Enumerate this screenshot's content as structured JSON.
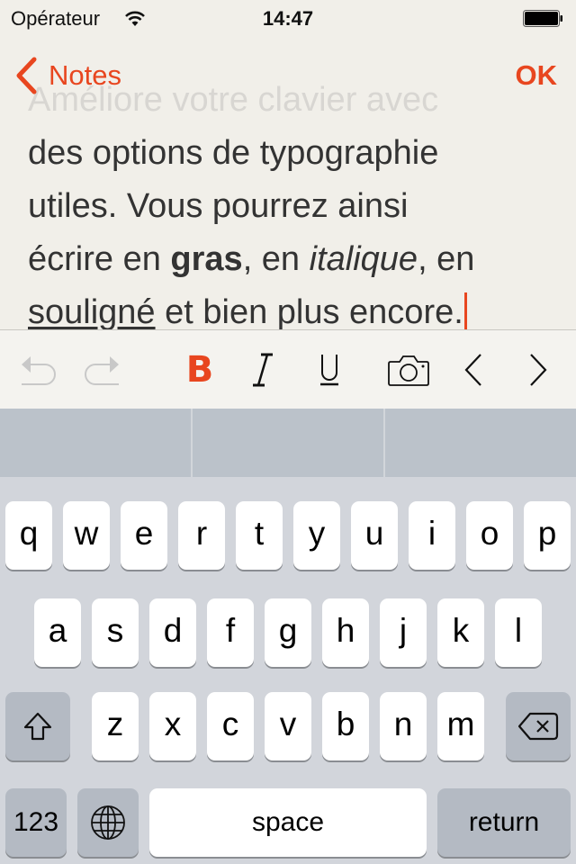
{
  "status_bar": {
    "carrier": "Opérateur",
    "time": "14:47",
    "wifi_icon": "wifi-icon",
    "battery_icon": "battery-full-icon"
  },
  "nav": {
    "back_label": "Notes",
    "back_icon": "chevron-left-icon",
    "done_label": "OK"
  },
  "note": {
    "line0": "Améliore votre clavier avec",
    "line1": "des options de typographie",
    "line2": "utiles. Vous pourrez ainsi",
    "line3_a": "écrire en ",
    "line3_bold": "gras",
    "line3_b": ", en ",
    "line3_italic": "italique",
    "line3_c": ", en",
    "line4_underline": "souligné",
    "line4_rest": " et bien plus encore."
  },
  "toolbar": {
    "undo_icon": "undo-icon",
    "redo_icon": "redo-icon",
    "bold_label": "B",
    "italic_icon": "italic-icon",
    "underline_icon": "underline-icon",
    "camera_icon": "camera-icon",
    "prev_icon": "chevron-left-icon",
    "next_icon": "chevron-right-icon",
    "active_format": "bold"
  },
  "suggestions": [
    "",
    "",
    ""
  ],
  "keyboard": {
    "row1": [
      "q",
      "w",
      "e",
      "r",
      "t",
      "y",
      "u",
      "i",
      "o",
      "p"
    ],
    "row2": [
      "a",
      "s",
      "d",
      "f",
      "g",
      "h",
      "j",
      "k",
      "l"
    ],
    "row3": [
      "z",
      "x",
      "c",
      "v",
      "b",
      "n",
      "m"
    ],
    "numbers_label": "123",
    "space_label": "space",
    "return_label": "return",
    "shift_icon": "shift-icon",
    "delete_icon": "delete-backspace-icon",
    "globe_icon": "globe-icon"
  },
  "colors": {
    "accent": "#e8461f",
    "text": "#333333",
    "paper": "#f1efe9",
    "keyboard_bg": "#d2d5db",
    "key_dark": "#b4bac3"
  }
}
